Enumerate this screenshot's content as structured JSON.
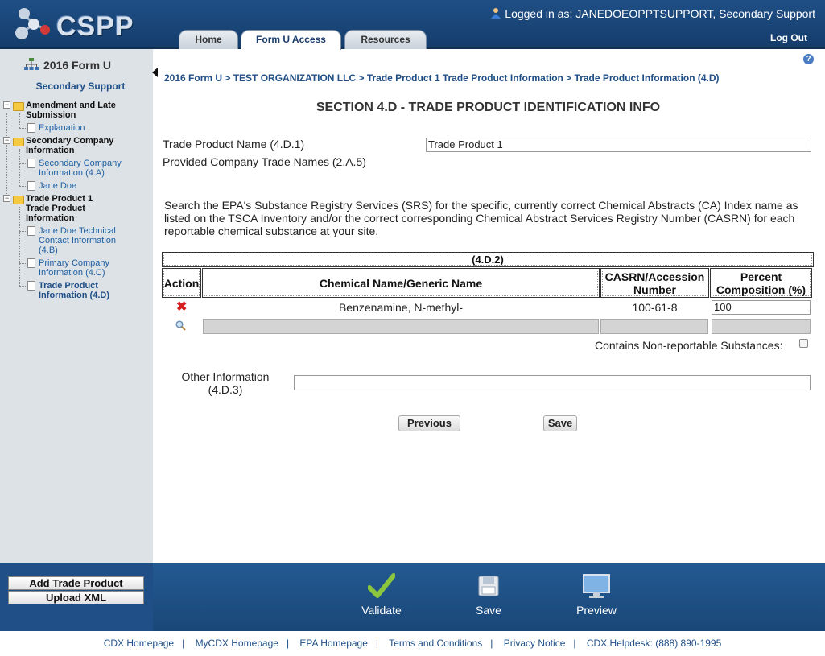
{
  "header": {
    "logo_text": "CSPP",
    "user_text": "Logged in as: JANEDOEOPPTSUPPORT, Secondary Support",
    "logout_label": "Log Out",
    "tabs": [
      {
        "label": "Home"
      },
      {
        "label": "Form U Access"
      },
      {
        "label": "Resources"
      }
    ]
  },
  "sidebar": {
    "title": "2016 Form U",
    "subtitle": "Secondary Support",
    "tree": [
      {
        "label": "Amendment and Late Submission",
        "type": "folder"
      },
      {
        "label": "Explanation",
        "type": "leaf"
      },
      {
        "label": "Secondary Company Information",
        "type": "folder"
      },
      {
        "label": "Secondary Company Information (4.A)",
        "type": "leaf"
      },
      {
        "label": "Jane Doe",
        "type": "leaf"
      },
      {
        "label": "Trade Product 1 Trade Product Information",
        "type": "folder"
      },
      {
        "label": "Jane Doe Technical Contact Information (4.B)",
        "type": "leaf"
      },
      {
        "label": "Primary Company Information (4.C)",
        "type": "leaf"
      },
      {
        "label": "Trade Product Information (4.D)",
        "type": "leaf"
      }
    ],
    "buttons": {
      "add_trade_product": "Add Trade Product",
      "upload_xml": "Upload XML"
    }
  },
  "breadcrumb": "2016 Form U > TEST ORGANIZATION LLC > Trade Product 1 Trade Product Information > Trade Product Information (4.D)",
  "section_title": "SECTION 4.D - TRADE PRODUCT IDENTIFICATION INFO",
  "form": {
    "trade_product_name_label": "Trade Product Name (4.D.1)",
    "trade_product_name_value": "Trade Product 1",
    "provided_names_label": "Provided Company Trade Names (2.A.5)",
    "search_instructions": "Search the EPA's Substance Registry Services (SRS) for the specific, currently correct Chemical Abstracts (CA) Index name as listed on the TSCA Inventory and/or the correct corresponding Chemical Abstract Services Registry Number (CASRN) for each reportable chemical substance at your site.",
    "other_info_label_1": "Other Information",
    "other_info_label_2": "(4.D.3)",
    "other_info_value": "",
    "non_reportable_label": "Contains Non-reportable Substances:"
  },
  "table": {
    "caption": "(4.D.2)",
    "headers": {
      "action": "Action",
      "chemical_name": "Chemical Name/Generic Name",
      "casrn_1": "CASRN/Accession",
      "casrn_2": "Number",
      "percent_1": "Percent",
      "percent_2": "Composition (%)"
    },
    "rows": [
      {
        "chemical_name": "Benzenamine, N-methyl-",
        "casrn": "100-61-8",
        "percent": "100"
      }
    ]
  },
  "nav_buttons": {
    "previous": "Previous",
    "save": "Save"
  },
  "bottom_actions": {
    "validate": "Validate",
    "save": "Save",
    "preview": "Preview"
  },
  "footer_links": [
    "CDX Homepage",
    "MyCDX Homepage",
    "EPA Homepage",
    "Terms and Conditions",
    "Privacy Notice",
    "CDX Helpdesk: (888) 890-1995"
  ],
  "colors": {
    "header_blue": "#1f4f86",
    "sidebar_grey": "#dde2e7",
    "link_blue": "#1f5fa0",
    "delete_red": "#d42020"
  }
}
